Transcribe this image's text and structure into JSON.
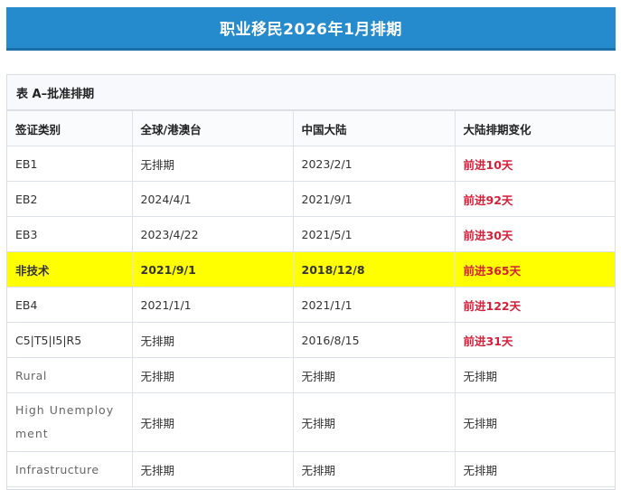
{
  "title": "职业移民2026年1月排期",
  "table": {
    "caption": "表 A–批准排期",
    "headers": [
      "签证类别",
      "全球/港澳台",
      "中国大陆",
      "大陆排期变化"
    ],
    "rows": [
      {
        "category": "EB1",
        "global": "无排期",
        "china": "2023/2/1",
        "change": "前进10天"
      },
      {
        "category": "EB2",
        "global": "2024/4/1",
        "china": "2021/9/1",
        "change": "前进92天"
      },
      {
        "category": "EB3",
        "global": "2023/4/22",
        "china": "2021/5/1",
        "change": "前进30天"
      },
      {
        "category": "非技术",
        "global": "2021/9/1",
        "china": "2018/12/8",
        "change": "前进365天"
      },
      {
        "category": "EB4",
        "global": "2021/1/1",
        "china": "2021/1/1",
        "change": "前进122天"
      },
      {
        "category": "C5|T5|I5|R5",
        "global": "无排期",
        "china": "2016/8/15",
        "change": "前进31天"
      },
      {
        "category": "Rural",
        "global": "无排期",
        "china": "无排期",
        "change": "无排期"
      },
      {
        "category": " High Unemployment",
        "global": "无排期",
        "china": "无排期",
        "change": "无排期"
      },
      {
        "category": "Infrastructure",
        "global": "无排期",
        "china": "无排期",
        "change": "无排期"
      }
    ]
  },
  "colors": {
    "banner": "#268bcc",
    "highlight": "#ffff00",
    "advance": "#d6203a"
  }
}
